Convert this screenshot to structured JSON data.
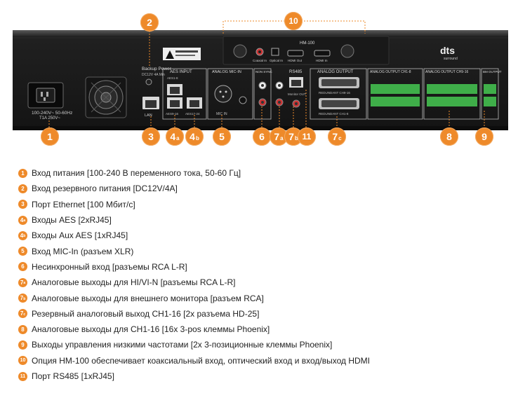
{
  "callouts": [
    {
      "num": "1",
      "sub": ""
    },
    {
      "num": "2",
      "sub": ""
    },
    {
      "num": "3",
      "sub": ""
    },
    {
      "num": "4",
      "sub": "a"
    },
    {
      "num": "4",
      "sub": "b"
    },
    {
      "num": "5",
      "sub": ""
    },
    {
      "num": "6",
      "sub": ""
    },
    {
      "num": "7",
      "sub": "a"
    },
    {
      "num": "7",
      "sub": "b"
    },
    {
      "num": "11",
      "sub": ""
    },
    {
      "num": "7",
      "sub": "c"
    },
    {
      "num": "8",
      "sub": ""
    },
    {
      "num": "9",
      "sub": ""
    },
    {
      "num": "10",
      "sub": ""
    }
  ],
  "panel_labels": {
    "power": "100-240V~ 50-60Hz",
    "power_sub": "T1A 250V~",
    "backup": "Backup Power",
    "backup_sub": "DC12V 4A Min",
    "lan": "LAN",
    "aes_input": "AES INPUT",
    "aes_sub1": "AES1-8",
    "aes_sub2": "AES9-16",
    "aes_sub3": "AES17-24",
    "analog_mic": "ANALOG MIC-IN",
    "mic_in": "MIC IN",
    "nonsync": "NON SYNC",
    "rs485": "RS485",
    "monitor": "Monitor OUT",
    "analog_output": "ANALOG OUTPUT",
    "redundant1": "REDUNDANT CH9-16",
    "redundant2": "REDUNDANT CH1-8",
    "aout18": "ANALOG OUTPUT CH1-8",
    "aout916": "ANALOG OUTPUT CH9-16",
    "bm_output": "BM OUTPUT",
    "hm100": "HM-100",
    "coax": "Coaxial In",
    "optical": "Optical In",
    "hdmi_out": "HDMI Out",
    "hdmi_in": "HDMI In",
    "dts": "dts",
    "surround": "surround"
  },
  "legend": [
    {
      "num": "1",
      "sub": "",
      "text": "Вход питания [100-240 В переменного тока, 50-60 Гц]"
    },
    {
      "num": "2",
      "sub": "",
      "text": "Вход резервного питания [DC12V/4A]"
    },
    {
      "num": "3",
      "sub": "",
      "text": "Порт Ethernet [100 Мбит/с]"
    },
    {
      "num": "4",
      "sub": "a",
      "text": "Входы AES [2xRJ45]"
    },
    {
      "num": "4",
      "sub": "b",
      "text": "Входы Aux AES [1xRJ45]"
    },
    {
      "num": "5",
      "sub": "",
      "text": "Вход MIC-In (разъем XLR)"
    },
    {
      "num": "6",
      "sub": "",
      "text": "Несинхронный вход [разъемы RCA L-R]"
    },
    {
      "num": "7",
      "sub": "a",
      "text": "Аналоговые выходы для HI/VI-N [разъемы RCA L-R]"
    },
    {
      "num": "7",
      "sub": "b",
      "text": "Аналоговые выходы для внешнего монитора [разъем RCA]"
    },
    {
      "num": "7",
      "sub": "c",
      "text": "Резервный аналоговый выход CH1-16 [2x разъема HD-25]"
    },
    {
      "num": "8",
      "sub": "",
      "text": "Аналоговые выходы для CH1-16 [16x 3-pos клеммы Phoenix]"
    },
    {
      "num": "9",
      "sub": "",
      "text": "Выходы управления низкими частотами [2x 3-позиционные клеммы Phoenix]"
    },
    {
      "num": "10",
      "sub": "",
      "text": "Опция HM-100 обеспечивает коаксиальный вход, оптический вход и вход/выход HDMI"
    },
    {
      "num": "11",
      "sub": "",
      "text": "Порт RS485 [1xRJ45]"
    }
  ]
}
